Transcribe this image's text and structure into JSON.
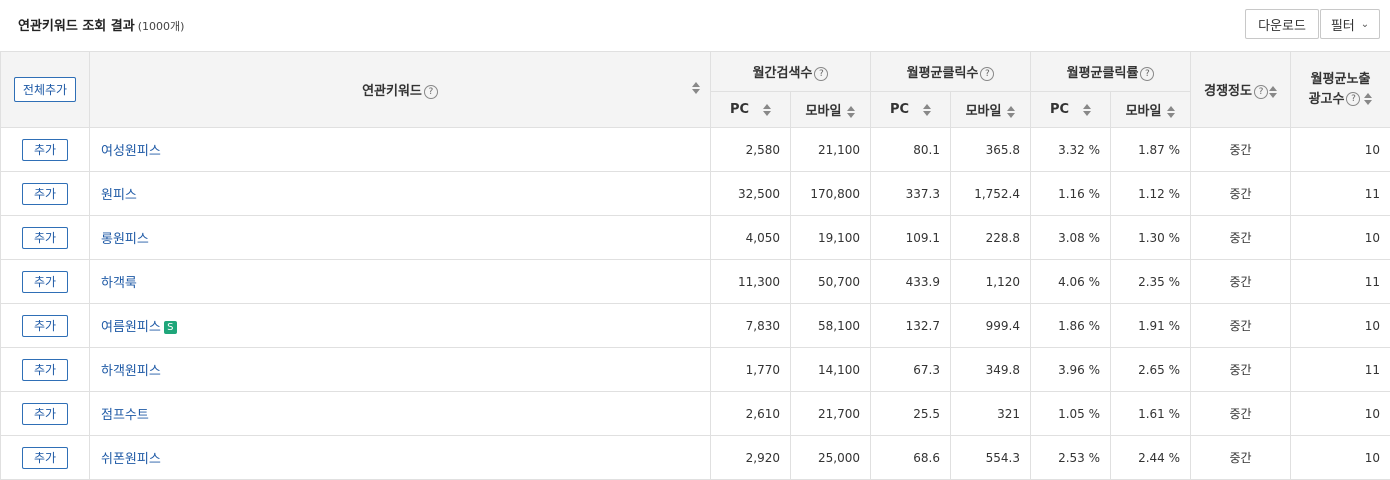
{
  "header": {
    "title": "연관키워드 조회 결과",
    "count": "(1000개)",
    "download_label": "다운로드",
    "filter_label": "필터",
    "help_glyph": "?"
  },
  "table": {
    "add_all_label": "전체추가",
    "col_keyword": "연관키워드",
    "col_monthly_search": "월간검색수",
    "col_avg_clicks": "월평균클릭수",
    "col_avg_ctr": "월평균클릭률",
    "col_competition": "경쟁정도",
    "col_ads_line1": "월평균노출",
    "col_ads_line2": "광고수",
    "sub_pc": "PC",
    "sub_mobile": "모바일",
    "add_label": "추가",
    "rows": [
      {
        "keyword": "여성원피스",
        "badge": "",
        "search_pc": "2,580",
        "search_mobile": "21,100",
        "clicks_pc": "80.1",
        "clicks_mobile": "365.8",
        "ctr_pc": "3.32 %",
        "ctr_mobile": "1.87 %",
        "competition": "중간",
        "ads": "10"
      },
      {
        "keyword": "원피스",
        "badge": "",
        "search_pc": "32,500",
        "search_mobile": "170,800",
        "clicks_pc": "337.3",
        "clicks_mobile": "1,752.4",
        "ctr_pc": "1.16 %",
        "ctr_mobile": "1.12 %",
        "competition": "중간",
        "ads": "11"
      },
      {
        "keyword": "롱원피스",
        "badge": "",
        "search_pc": "4,050",
        "search_mobile": "19,100",
        "clicks_pc": "109.1",
        "clicks_mobile": "228.8",
        "ctr_pc": "3.08 %",
        "ctr_mobile": "1.30 %",
        "competition": "중간",
        "ads": "10"
      },
      {
        "keyword": "하객룩",
        "badge": "",
        "search_pc": "11,300",
        "search_mobile": "50,700",
        "clicks_pc": "433.9",
        "clicks_mobile": "1,120",
        "ctr_pc": "4.06 %",
        "ctr_mobile": "2.35 %",
        "competition": "중간",
        "ads": "11"
      },
      {
        "keyword": "여름원피스",
        "badge": "S",
        "search_pc": "7,830",
        "search_mobile": "58,100",
        "clicks_pc": "132.7",
        "clicks_mobile": "999.4",
        "ctr_pc": "1.86 %",
        "ctr_mobile": "1.91 %",
        "competition": "중간",
        "ads": "10"
      },
      {
        "keyword": "하객원피스",
        "badge": "",
        "search_pc": "1,770",
        "search_mobile": "14,100",
        "clicks_pc": "67.3",
        "clicks_mobile": "349.8",
        "ctr_pc": "3.96 %",
        "ctr_mobile": "2.65 %",
        "competition": "중간",
        "ads": "11"
      },
      {
        "keyword": "점프수트",
        "badge": "",
        "search_pc": "2,610",
        "search_mobile": "21,700",
        "clicks_pc": "25.5",
        "clicks_mobile": "321",
        "ctr_pc": "1.05 %",
        "ctr_mobile": "1.61 %",
        "competition": "중간",
        "ads": "10"
      },
      {
        "keyword": "쉬폰원피스",
        "badge": "",
        "search_pc": "2,920",
        "search_mobile": "25,000",
        "clicks_pc": "68.6",
        "clicks_mobile": "554.3",
        "ctr_pc": "2.53 %",
        "ctr_mobile": "2.44 %",
        "competition": "중간",
        "ads": "10"
      }
    ]
  },
  "colors": {
    "link": "#1f5aa6",
    "badge": "#1fa67a",
    "header_bg": "#f4f4f4"
  }
}
